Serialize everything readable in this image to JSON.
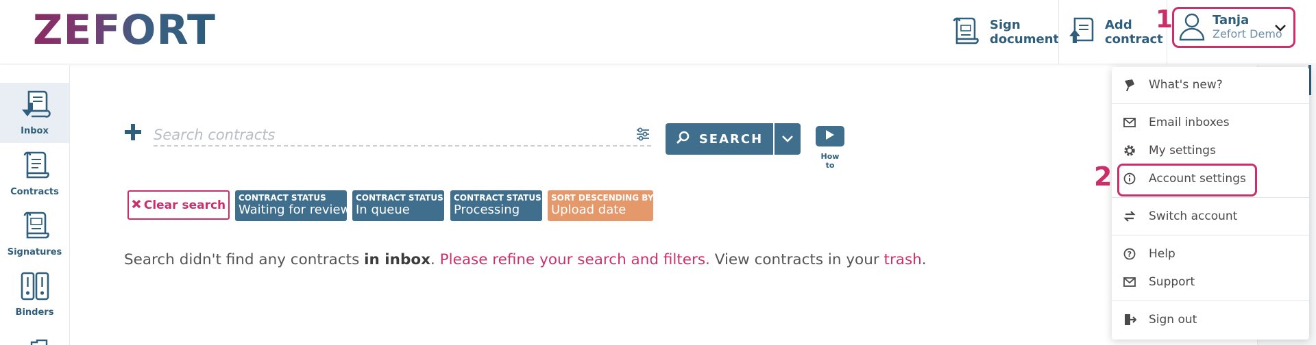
{
  "header": {
    "logo": "ZEFORT",
    "sign_document": [
      "Sign",
      "document"
    ],
    "add_contract": [
      "Add",
      "contract"
    ],
    "user": {
      "name": "Tanja",
      "org": "Zefort Demo"
    }
  },
  "steps": {
    "one": "1",
    "two": "2"
  },
  "sidebar": {
    "items": [
      {
        "label": "Inbox",
        "icon": "inbox-icon"
      },
      {
        "label": "Contracts",
        "icon": "contracts-icon"
      },
      {
        "label": "Signatures",
        "icon": "signatures-icon"
      },
      {
        "label": "Binders",
        "icon": "binders-icon"
      }
    ]
  },
  "search": {
    "placeholder": "Search contracts",
    "button_label": "SEARCH",
    "howto_label": "How to"
  },
  "filters": {
    "clear_label": "Clear search",
    "chips": [
      {
        "head": "CONTRACT STATUS",
        "value": "Waiting for review",
        "color": "#3f6f8d"
      },
      {
        "head": "CONTRACT STATUS",
        "value": "In queue",
        "color": "#3f6f8d"
      },
      {
        "head": "CONTRACT STATUS",
        "value": "Processing",
        "color": "#3f6f8d"
      },
      {
        "head": "SORT DESCENDING BY",
        "value": "Upload date",
        "color": "#e5986a"
      }
    ]
  },
  "message": {
    "part1": "Search didn't find any contracts ",
    "bold": "in inbox",
    "part2": ". ",
    "refine": "Please refine your search and filters.",
    "part3": " View contracts in your ",
    "trash": "trash",
    "part4": "."
  },
  "menu": {
    "items": [
      {
        "label": "What's new?",
        "icon": "megaphone-icon"
      },
      {
        "label": "Email inboxes",
        "icon": "envelope-icon"
      },
      {
        "label": "My settings",
        "icon": "gear-icon"
      },
      {
        "label": "Account settings",
        "icon": "info-icon"
      },
      {
        "label": "Switch account",
        "icon": "switch-icon"
      },
      {
        "label": "Help",
        "icon": "question-icon"
      },
      {
        "label": "Support",
        "icon": "envelope-icon"
      },
      {
        "label": "Sign out",
        "icon": "sign-out-icon"
      }
    ]
  },
  "colors": {
    "brand_blue": "#3f6f8d",
    "highlight_pink": "#cc2e6a",
    "sort_orange": "#e5986a"
  }
}
